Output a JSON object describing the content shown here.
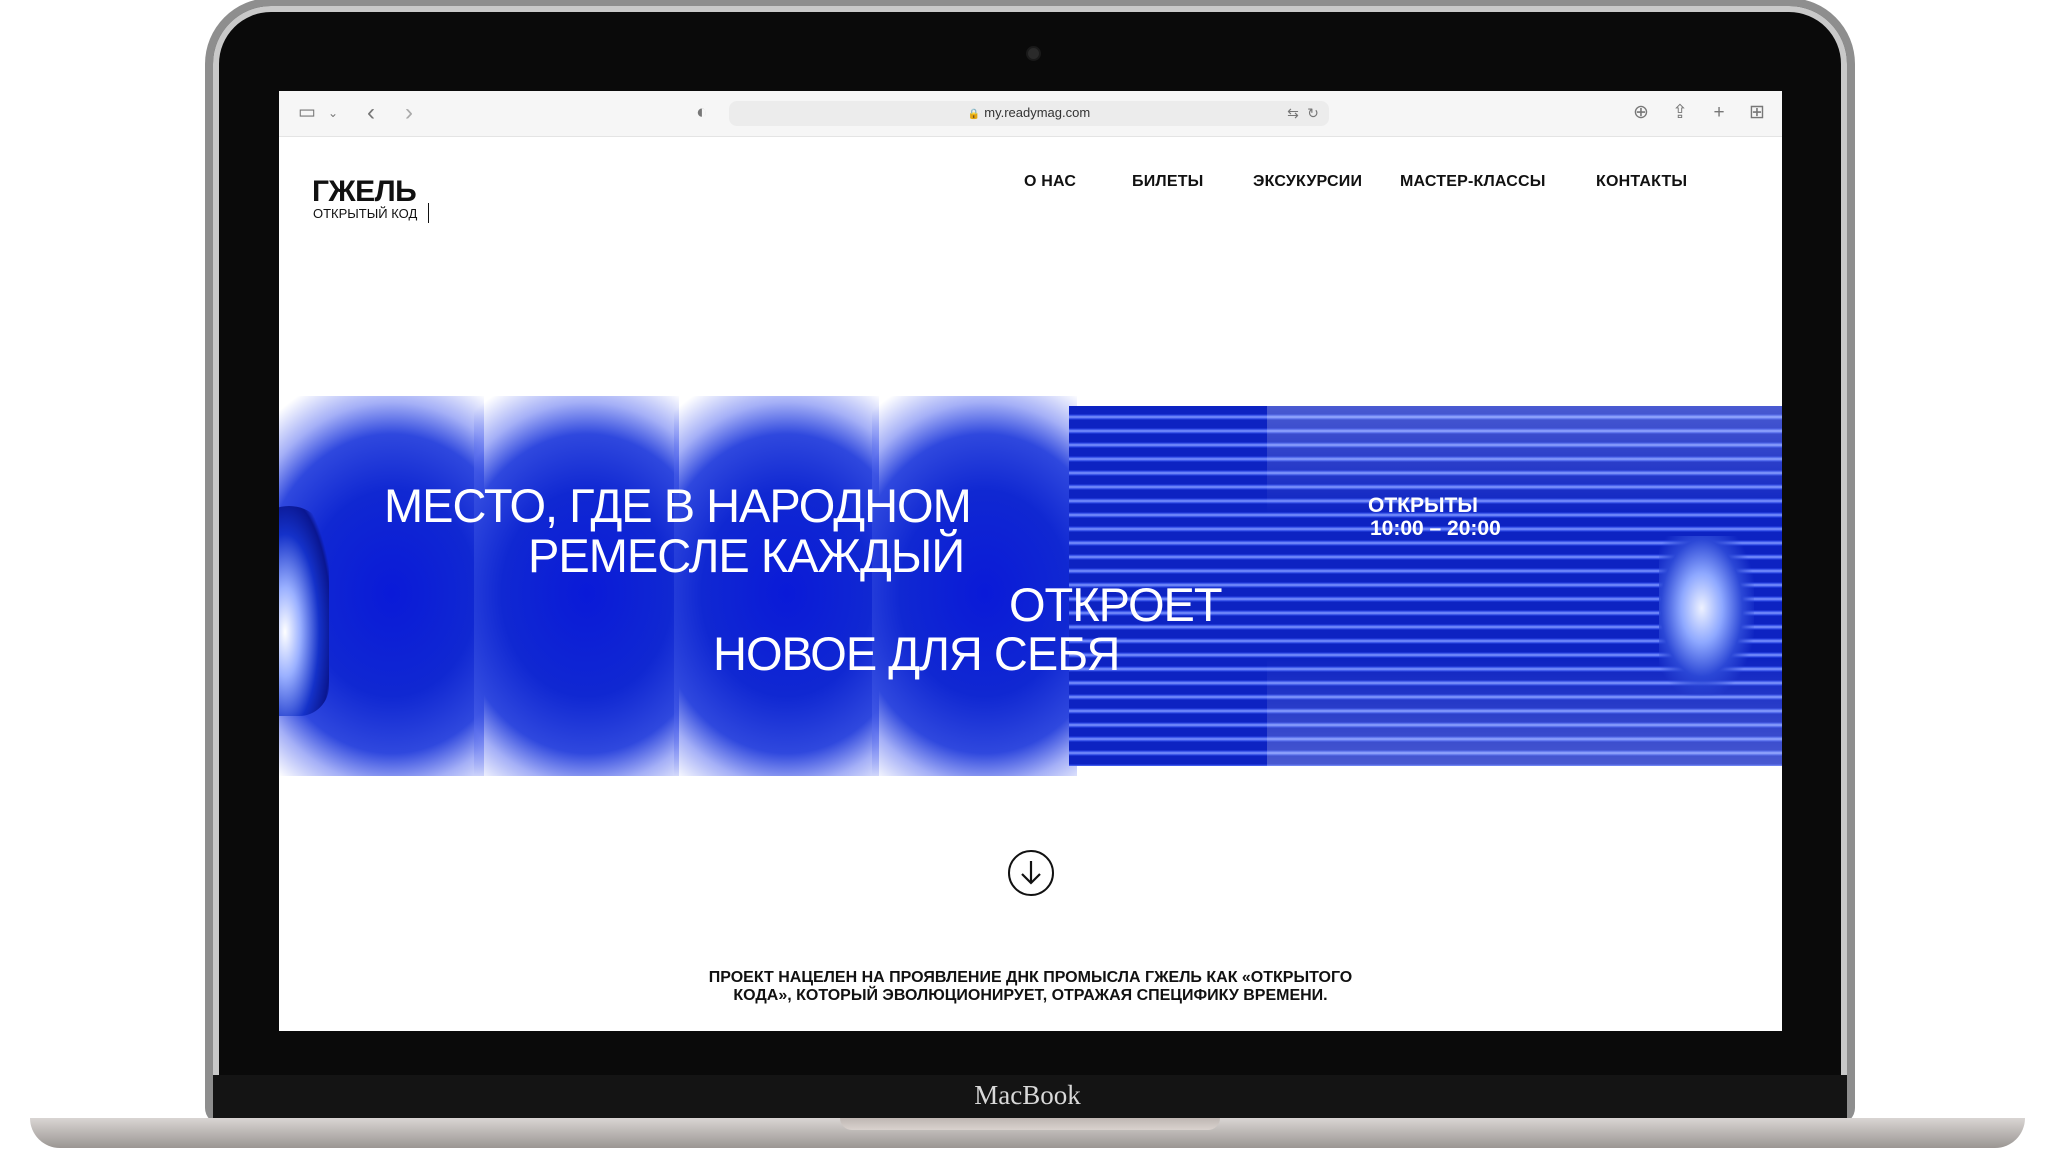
{
  "browser": {
    "url": "my.readymag.com",
    "icons": [
      "sidebar-icon",
      "chevron-down-icon",
      "back-icon",
      "forward-icon",
      "shield-icon",
      "lock-icon",
      "translate-icon",
      "reload-icon",
      "download-icon",
      "share-icon",
      "new-tab-icon",
      "tab-overview-icon"
    ]
  },
  "site": {
    "logo_title": "ГЖЕЛЬ",
    "logo_subtitle": "ОТКРЫТЫЙ КОД",
    "nav": [
      "О НАС",
      "БИЛЕТЫ",
      "ЭКСУКУРСИИ",
      "МАСТЕР-КЛАССЫ",
      "КОНТАКТЫ"
    ],
    "hero": {
      "line1": "МЕСТО, ГДЕ В НАРОДНОМ",
      "line2": "РЕМЕСЛЕ КАЖДЫЙ",
      "line3": "ОТКРОЕТ",
      "line4": "НОВОЕ ДЛЯ СЕБЯ",
      "hours_label": "ОТКРЫТЫ",
      "hours_time": "10:00 – 20:00"
    },
    "footer_line1": "ПРОЕКТ НАЦЕЛЕН НА ПРОЯВЛЕНИЕ ДНК ПРОМЫСЛА ГЖЕЛЬ КАК «ОТКРЫТОГО",
    "footer_line2": "КОДА», КОТОРЫЙ ЭВОЛЮЦИОНИРУЕТ, ОТРАЖАЯ СПЕЦИФИКУ ВРЕМЕНИ."
  },
  "device": {
    "brand": "MacBook"
  },
  "colors": {
    "accent_blue": "#0d23c2",
    "text": "#111111"
  }
}
